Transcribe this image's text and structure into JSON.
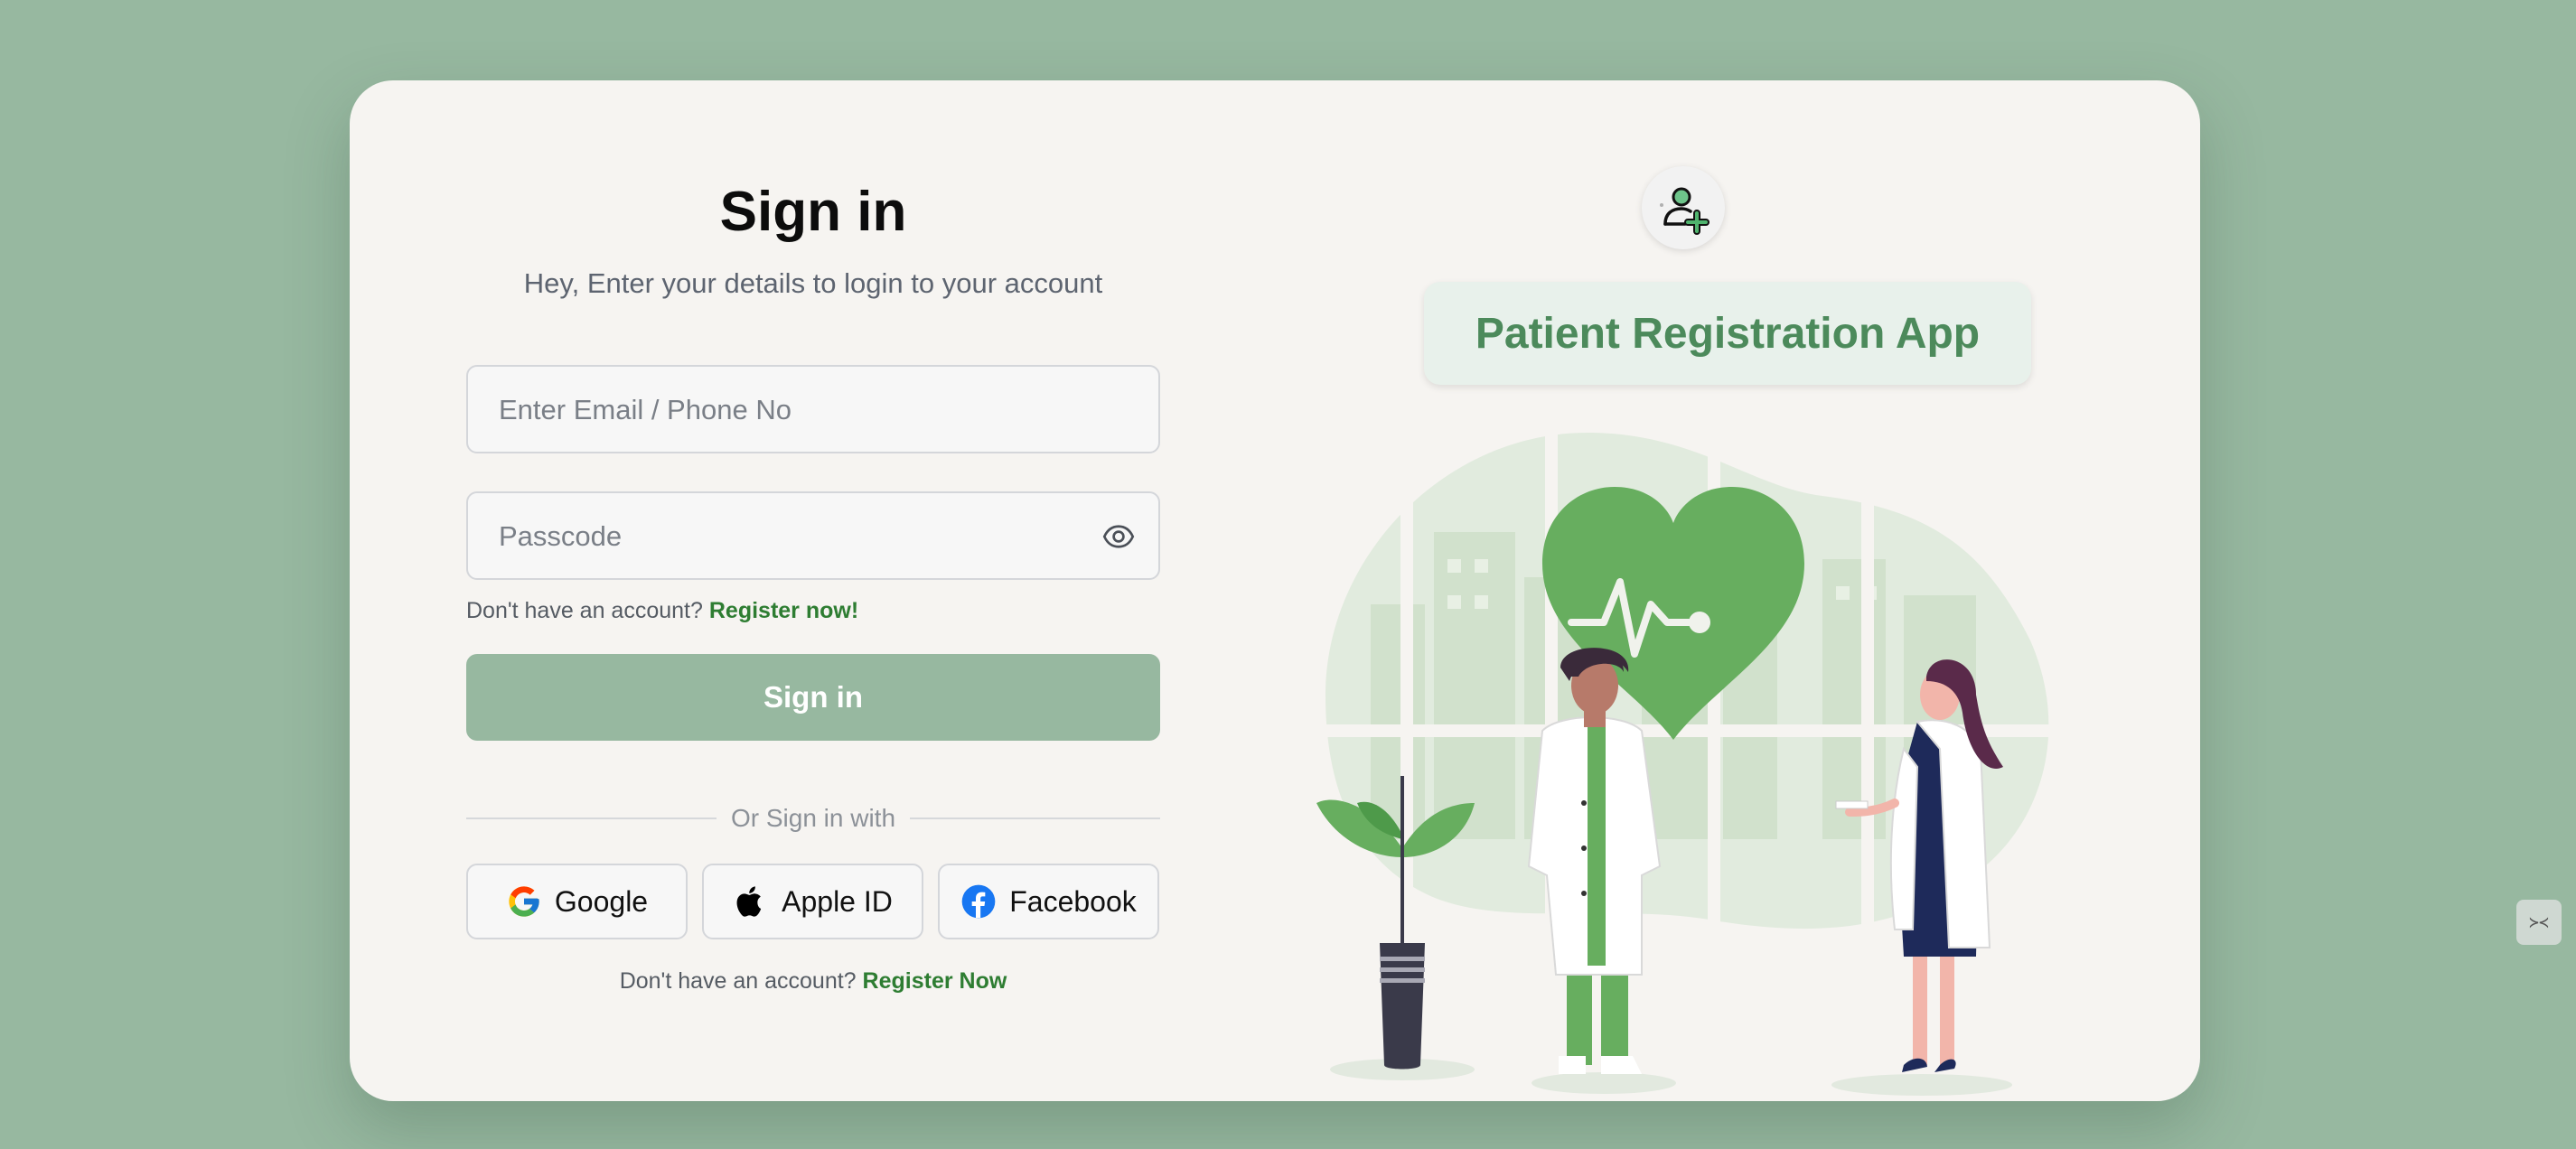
{
  "login": {
    "title": "Sign in",
    "subtitle": "Hey, Enter your details to login to your account",
    "email_placeholder": "Enter Email / Phone No",
    "passcode_placeholder": "Passcode",
    "register_prompt": "Don't have an account?",
    "register_link": "Register now!",
    "signin_button": "Sign in",
    "divider_text": "Or Sign in with",
    "social": [
      {
        "label": "Google",
        "icon": "google-icon"
      },
      {
        "label": "Apple ID",
        "icon": "apple-icon"
      },
      {
        "label": "Facebook",
        "icon": "facebook-icon"
      }
    ],
    "footer_prompt": "Don't have an account?",
    "footer_link": "Register Now"
  },
  "hero": {
    "app_icon": "add-user-icon",
    "app_title": "Patient Registration App",
    "illustration": "doctors-heart-illustration"
  },
  "side_tab": {
    "icon": "bookmark-tab-icon",
    "glyph": "≻≺"
  },
  "colors": {
    "background": "#97b8a0",
    "card": "#f6f4f1",
    "accent_green": "#2e7d32",
    "button": "#97b8a0",
    "app_title_text": "#4c8a5b"
  }
}
